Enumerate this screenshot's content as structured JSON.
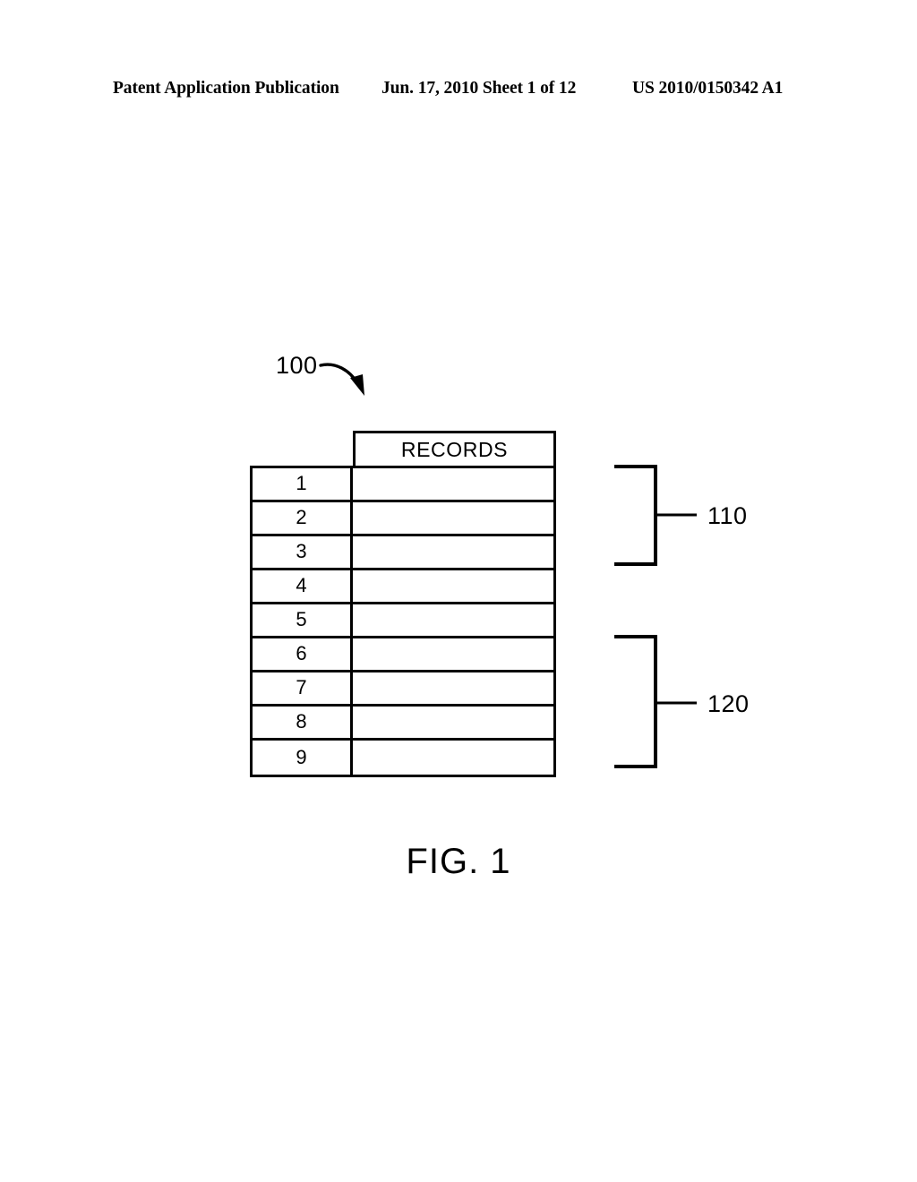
{
  "header": {
    "left": "Patent Application Publication",
    "middle": "Jun. 17, 2010  Sheet 1 of 12",
    "right": "US 2010/0150342 A1"
  },
  "figure": {
    "caption": "FIG. 1",
    "diagram_reference": "100",
    "table": {
      "column_header": "RECORDS",
      "rows": [
        {
          "number": "1",
          "record": ""
        },
        {
          "number": "2",
          "record": ""
        },
        {
          "number": "3",
          "record": ""
        },
        {
          "number": "4",
          "record": ""
        },
        {
          "number": "5",
          "record": ""
        },
        {
          "number": "6",
          "record": ""
        },
        {
          "number": "7",
          "record": ""
        },
        {
          "number": "8",
          "record": ""
        },
        {
          "number": "9",
          "record": ""
        }
      ]
    },
    "groups": [
      {
        "label": "110",
        "spans_rows": "1-3"
      },
      {
        "label": "120",
        "spans_rows": "6-9"
      }
    ]
  },
  "colors": {
    "ink": "#000000",
    "page": "#ffffff"
  }
}
